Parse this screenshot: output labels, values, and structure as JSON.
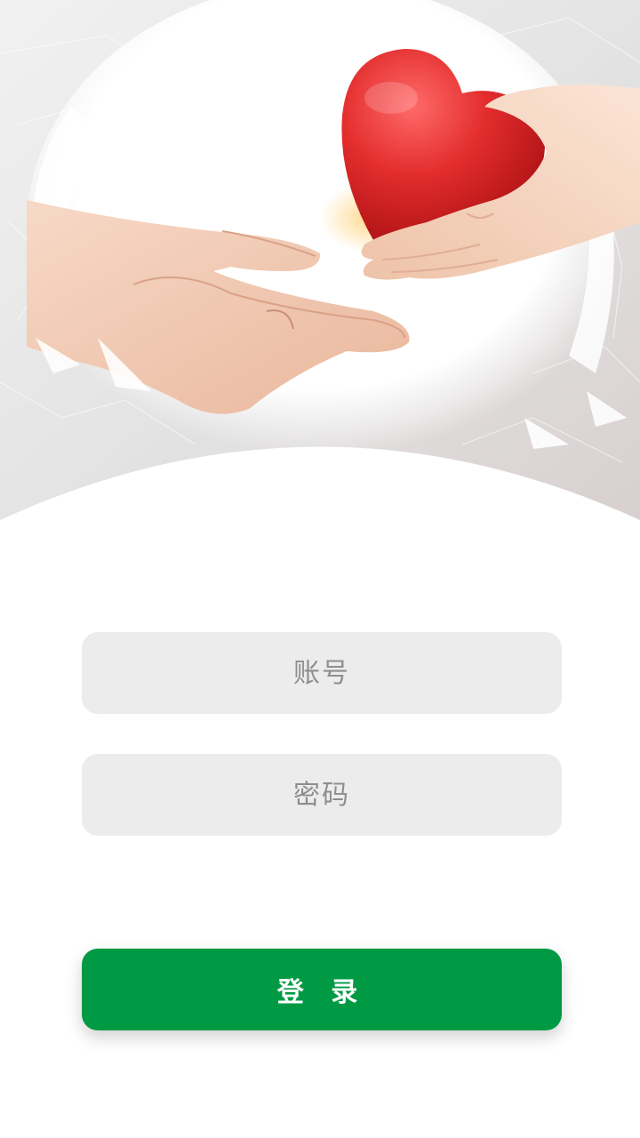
{
  "hero": {
    "image": "hands-giving-heart-illustration",
    "accent_color": "#e62d2d"
  },
  "form": {
    "account": {
      "placeholder": "账号",
      "value": ""
    },
    "password": {
      "placeholder": "密码",
      "value": ""
    },
    "login_label": "登 录"
  },
  "colors": {
    "primary_green": "#009a44",
    "input_background": "#ececec",
    "placeholder_text": "#8e8e8e",
    "background": "#ffffff"
  }
}
